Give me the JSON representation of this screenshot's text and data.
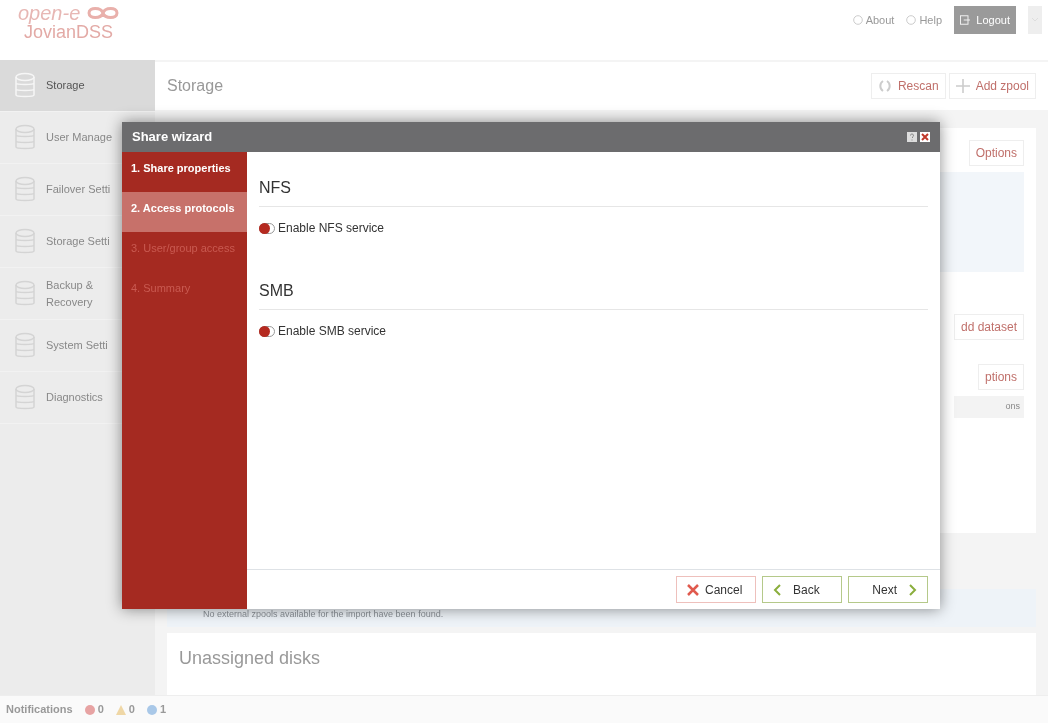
{
  "header": {
    "logo_top": "open-e",
    "logo_bottom": "JovianDSS",
    "links": [
      "About",
      "Help"
    ],
    "logout": "Logout"
  },
  "sidebar": {
    "items": [
      {
        "label": "Storage",
        "selected": true
      },
      {
        "label": "User Manage",
        "selected": false
      },
      {
        "label": "Failover Setti",
        "selected": false
      },
      {
        "label": "Storage Setti",
        "selected": false
      },
      {
        "label": "Backup & Recovery",
        "selected": false
      },
      {
        "label": "System Setti",
        "selected": false
      },
      {
        "label": "Diagnostics",
        "selected": false
      }
    ]
  },
  "page": {
    "title": "Storage",
    "actions": [
      "Rescan",
      "Add zpool"
    ],
    "options_1": "Options",
    "add_dataset": "dd dataset",
    "options_2": "ptions",
    "options_row": "ons",
    "import_note": "No external zpools available for the import have been found.",
    "unassigned_title": "Unassigned disks"
  },
  "notifications": {
    "label": "Notifications",
    "errors": "0",
    "warnings": "0",
    "info": "1"
  },
  "dialog": {
    "title": "Share wizard",
    "steps": [
      {
        "label": "1. Share properties",
        "selected": false,
        "disabled": false
      },
      {
        "label": "2. Access protocols",
        "selected": true,
        "disabled": false
      },
      {
        "label": "3. User/group access",
        "selected": false,
        "disabled": true
      },
      {
        "label": "4. Summary",
        "selected": false,
        "disabled": true
      }
    ],
    "sections": [
      {
        "heading": "NFS",
        "toggle_label": "Enable NFS service",
        "on": false
      },
      {
        "heading": "SMB",
        "toggle_label": "Enable SMB service",
        "on": false
      }
    ],
    "buttons": {
      "cancel": "Cancel",
      "back": "Back",
      "next": "Next"
    }
  }
}
